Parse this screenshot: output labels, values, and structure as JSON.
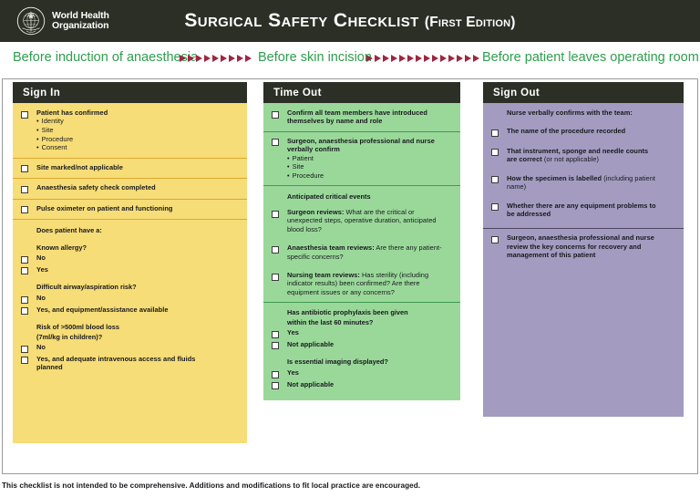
{
  "header": {
    "org_line1": "World Health",
    "org_line2": "Organization",
    "logo_icon": "who-emblem-icon",
    "title": "Surgical Safety Checklist",
    "edition": "(First Edition)"
  },
  "phases": {
    "phase1": "Before induction of anaesthesia",
    "phase2": "Before skin incision",
    "phase3": "Before patient leaves operating room",
    "arrows_group1_count": 9,
    "arrows_group2_count": 14,
    "arrow_color": "#9c2743",
    "label_color": "#2e9e4e"
  },
  "columns": {
    "signin": {
      "heading": "Sign In",
      "bg_color": "#f7dd77",
      "groups": [
        {
          "lead": "Patient has confirmed",
          "bullets": [
            "Identity",
            "Site",
            "Procedure",
            "Consent"
          ]
        },
        {
          "lead": "Site marked/not applicable"
        },
        {
          "lead": "Anaesthesia safety check completed"
        },
        {
          "lead": "Pulse oximeter on patient and functioning"
        },
        {
          "intro": "Does patient have a:",
          "questions": [
            {
              "q": "Known allergy?",
              "options": [
                "No",
                "Yes"
              ]
            },
            {
              "q": "Difficult airway/aspiration risk?",
              "options": [
                "No",
                "Yes, and equipment/assistance available"
              ]
            },
            {
              "q_line1": "Risk of >500ml blood loss",
              "q_line2": "(7ml/kg in children)?",
              "options": [
                "No",
                "Yes, and adequate intravenous access and fluids planned"
              ]
            }
          ]
        }
      ]
    },
    "timeout": {
      "heading": "Time Out",
      "bg_color": "#9ad89a",
      "groups": [
        {
          "lead": "Confirm all team members have introduced themselves by name and role"
        },
        {
          "lead": "Surgeon, anaesthesia professional and nurse verbally confirm",
          "bullets": [
            "Patient",
            "Site",
            "Procedure"
          ]
        },
        {
          "intro": "Anticipated critical events",
          "items": [
            {
              "bold": "Surgeon reviews:",
              "rest": " What are the critical or unexpected steps, operative duration, anticipated blood loss?"
            },
            {
              "bold": "Anaesthesia team reviews:",
              "rest": " Are there any patient-specific concerns?"
            },
            {
              "bold": "Nursing team reviews:",
              "rest": " Has sterility (including indicator results) been confirmed? Are there equipment issues or any concerns?"
            }
          ]
        },
        {
          "questions": [
            {
              "q_line1": "Has antibiotic prophylaxis been given",
              "q_line2": "within the last 60 minutes?",
              "options": [
                "Yes",
                "Not applicable"
              ]
            },
            {
              "q": "Is essential imaging displayed?",
              "options": [
                "Yes",
                "Not applicable"
              ]
            }
          ]
        }
      ]
    },
    "signout": {
      "heading": "Sign Out",
      "bg_color": "#a39cc0",
      "groups": [
        {
          "intro": "Nurse verbally confirms with the team:",
          "items": [
            {
              "bold": "The name of the procedure recorded",
              "rest": ""
            },
            {
              "bold": "That instrument, sponge and needle counts are correct",
              "rest": " (or not applicable)"
            },
            {
              "bold": "How the specimen is labelled",
              "rest": " (including patient name)"
            },
            {
              "bold": "Whether there are any equipment problems to be addressed",
              "rest": ""
            }
          ]
        },
        {
          "items": [
            {
              "bold": "Surgeon, anaesthesia professional and nurse review the key concerns for recovery and management of this patient",
              "rest": ""
            }
          ]
        }
      ]
    }
  },
  "footer": {
    "note": "This checklist is not intended to be comprehensive. Additions and modifications to fit local practice are encouraged."
  }
}
